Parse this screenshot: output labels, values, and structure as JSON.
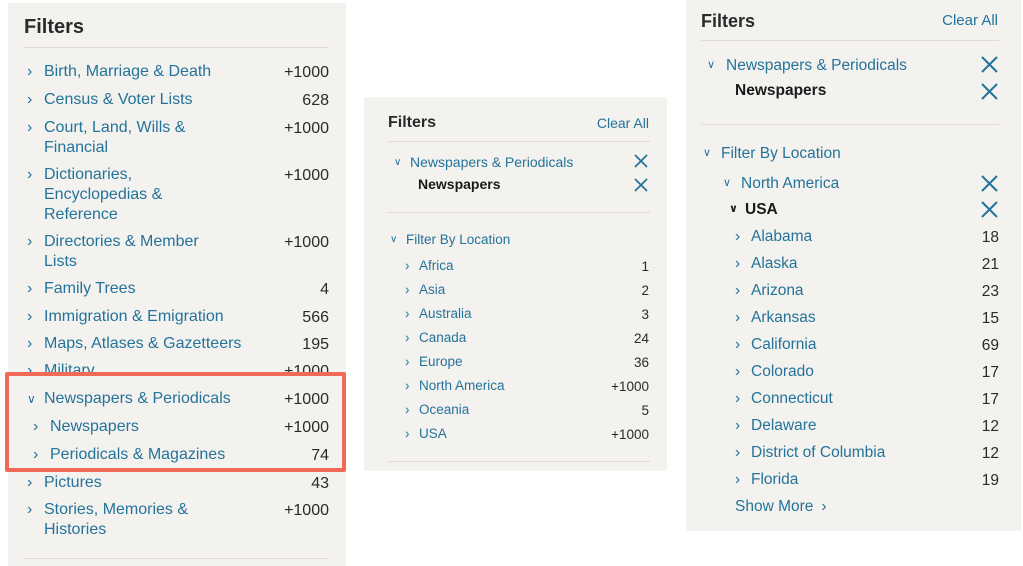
{
  "panel1": {
    "title": "Filters",
    "items": [
      {
        "label": "Birth, Marriage & Death",
        "count": "+1000"
      },
      {
        "label": "Census & Voter Lists",
        "count": "628"
      },
      {
        "label": "Court, Land, Wills & Financial",
        "count": "+1000"
      },
      {
        "label": "Dictionaries, Encyclopedias & Reference",
        "count": "+1000"
      },
      {
        "label": "Directories & Member Lists",
        "count": "+1000"
      },
      {
        "label": "Family Trees",
        "count": "4"
      },
      {
        "label": "Immigration & Emigration",
        "count": "566"
      },
      {
        "label": "Maps, Atlases & Gazetteers",
        "count": "195"
      },
      {
        "label": "Military",
        "count": "+1000"
      },
      {
        "label": "Newspapers & Periodicals",
        "count": "+1000"
      },
      {
        "label": "Newspapers",
        "count": "+1000"
      },
      {
        "label": "Periodicals & Magazines",
        "count": "74"
      },
      {
        "label": "Pictures",
        "count": "43"
      },
      {
        "label": "Stories, Memories & Histories",
        "count": "+1000"
      }
    ]
  },
  "panel2": {
    "title": "Filters",
    "clear_all": "Clear All",
    "selected_category": "Newspapers & Periodicals",
    "selected_subcategory": "Newspapers",
    "location_header": "Filter By Location",
    "locations": [
      {
        "label": "Africa",
        "count": "1"
      },
      {
        "label": "Asia",
        "count": "2"
      },
      {
        "label": "Australia",
        "count": "3"
      },
      {
        "label": "Canada",
        "count": "24"
      },
      {
        "label": "Europe",
        "count": "36"
      },
      {
        "label": "North America",
        "count": "+1000"
      },
      {
        "label": "Oceania",
        "count": "5"
      },
      {
        "label": "USA",
        "count": "+1000"
      }
    ]
  },
  "panel3": {
    "title": "Filters",
    "clear_all": "Clear All",
    "selected_category": "Newspapers & Periodicals",
    "selected_subcategory": "Newspapers",
    "location_header": "Filter By Location",
    "region": "North America",
    "country": "USA",
    "states": [
      {
        "label": "Alabama",
        "count": "18"
      },
      {
        "label": "Alaska",
        "count": "21"
      },
      {
        "label": "Arizona",
        "count": "23"
      },
      {
        "label": "Arkansas",
        "count": "15"
      },
      {
        "label": "California",
        "count": "69"
      },
      {
        "label": "Colorado",
        "count": "17"
      },
      {
        "label": "Connecticut",
        "count": "17"
      },
      {
        "label": "Delaware",
        "count": "12"
      },
      {
        "label": "District of Columbia",
        "count": "12"
      },
      {
        "label": "Florida",
        "count": "19"
      }
    ],
    "show_more": "Show More"
  },
  "colors": {
    "link": "#23739a",
    "panel_bg": "#f4f2ef",
    "highlight": "#f06a55"
  },
  "icons": [
    "chevron-right-icon",
    "chevron-down-icon",
    "close-icon"
  ]
}
